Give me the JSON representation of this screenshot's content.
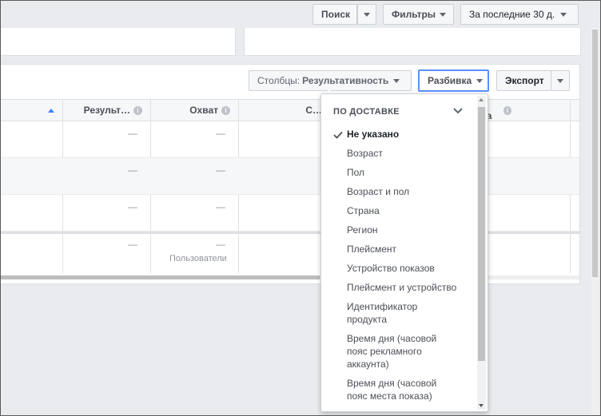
{
  "toolbar": {
    "search_label": "Поиск",
    "filters_label": "Фильтры",
    "date_range_label": "За последние 30 д."
  },
  "actions": {
    "columns_prefix": "Столбцы:",
    "columns_value": "Результативность",
    "breakdown_label": "Разбивка",
    "export_label": "Экспорт"
  },
  "table": {
    "headers": [
      "Результ…",
      "Охват",
      "С…",
      "…ма"
    ],
    "dash": "—",
    "users_caption": "Пользователи"
  },
  "breakdown_menu": {
    "section_title": "ПО ДОСТАВКЕ",
    "items": [
      "Не указано",
      "Возраст",
      "Пол",
      "Возраст и пол",
      "Страна",
      "Регион",
      "Плейсмент",
      "Устройство показов",
      "Плейсмент и устройство",
      "Идентификатор продукта",
      "Время дня (часовой пояс рекламного аккаунта)",
      "Время дня (часовой пояс места показа)"
    ],
    "selected_index": 0
  },
  "icons": {
    "check": "check-icon",
    "chevron": "chevron-down-icon",
    "sort": "sort-up-icon",
    "info": "info-icon"
  }
}
